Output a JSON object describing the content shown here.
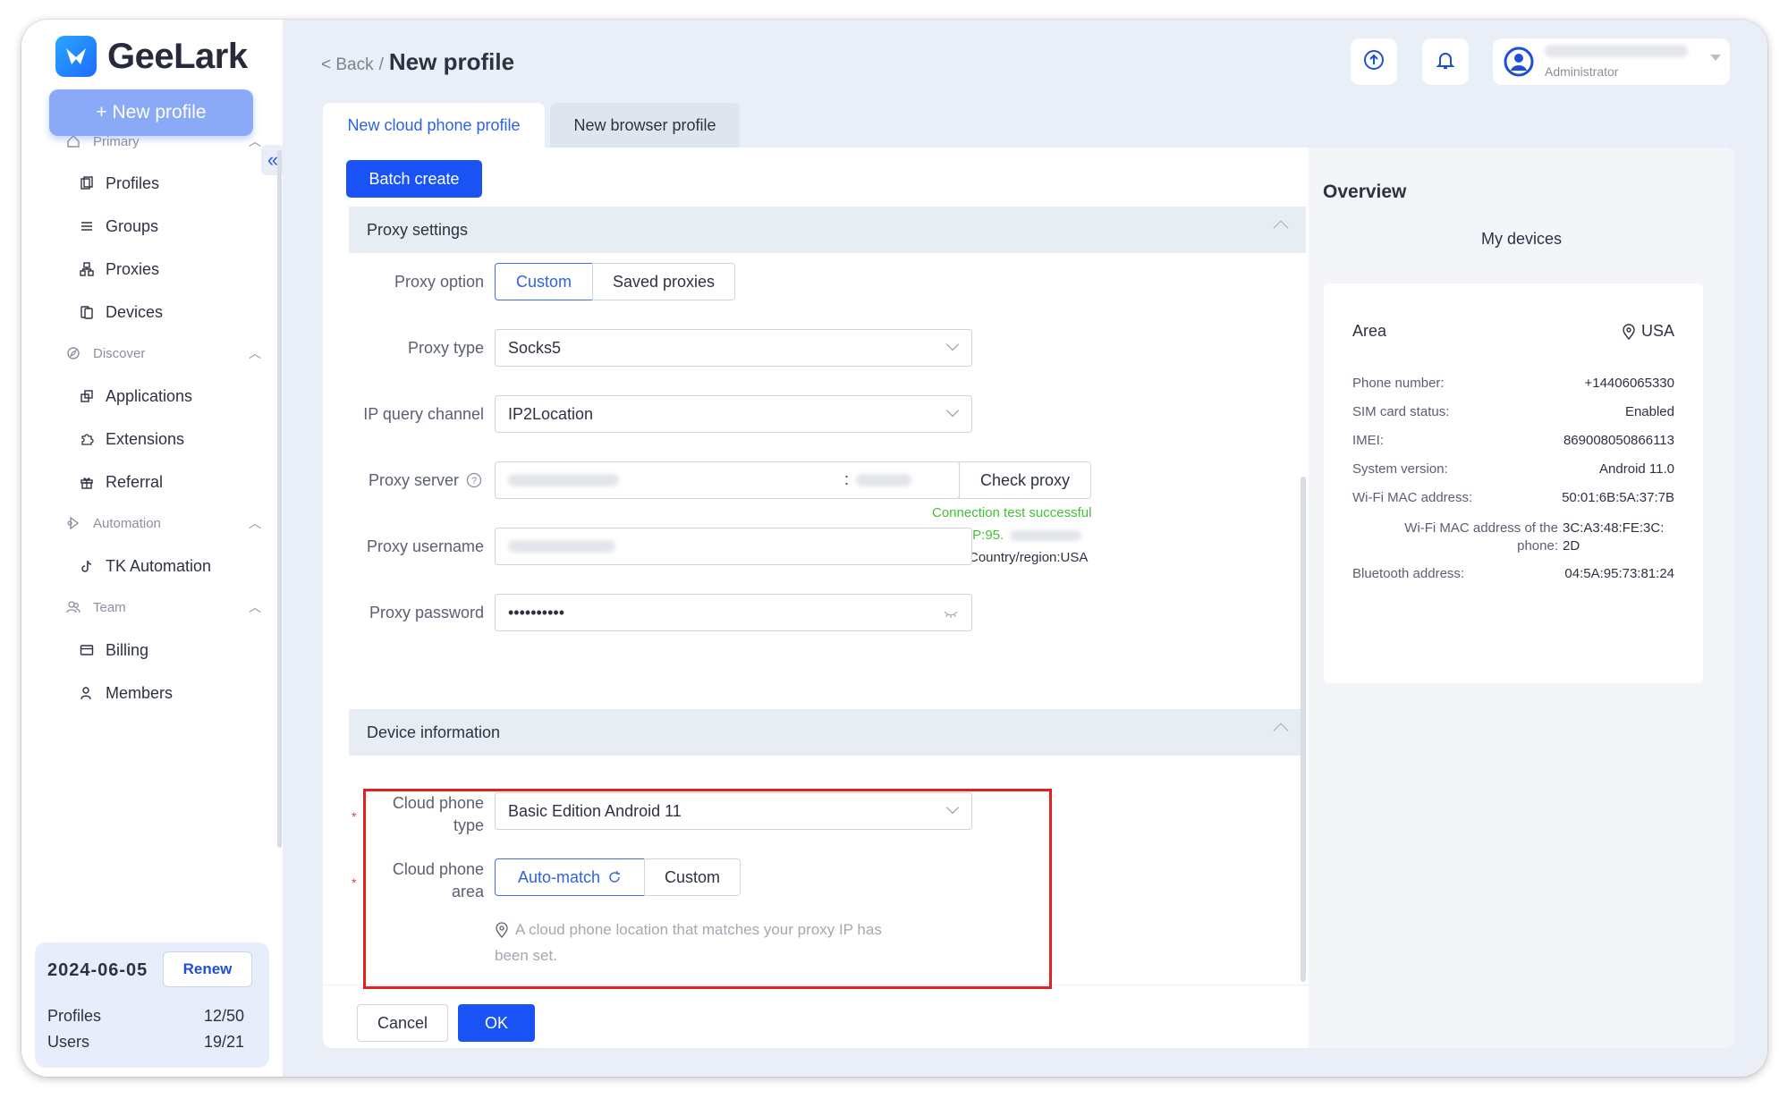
{
  "app": {
    "name": "GeeLark"
  },
  "sidebar": {
    "new_profile": "+ New profile",
    "collapse": "«",
    "sections": [
      {
        "label": "Primary",
        "items": [
          "Profiles",
          "Groups",
          "Proxies",
          "Devices"
        ]
      },
      {
        "label": "Discover",
        "items": [
          "Applications",
          "Extensions",
          "Referral"
        ]
      },
      {
        "label": "Automation",
        "items": [
          "TK Automation"
        ]
      },
      {
        "label": "Team",
        "items": [
          "Billing",
          "Members"
        ]
      }
    ],
    "plan": {
      "date": "2024-06-05",
      "renew": "Renew",
      "profiles_label": "Profiles",
      "profiles_value": "12/50",
      "users_label": "Users",
      "users_value": "19/21"
    }
  },
  "header": {
    "back": "< Back",
    "sep": "/",
    "title": "New profile",
    "user_role": "Administrator"
  },
  "tabs": [
    {
      "label": "New cloud phone profile",
      "active": true
    },
    {
      "label": "New browser profile",
      "active": false
    }
  ],
  "form": {
    "batch_create": "Batch create",
    "proxy_section": "Proxy settings",
    "proxy_option_label": "Proxy option",
    "proxy_option_custom": "Custom",
    "proxy_option_saved": "Saved proxies",
    "proxy_type_label": "Proxy type",
    "proxy_type_value": "Socks5",
    "ip_channel_label": "IP query channel",
    "ip_channel_value": "IP2Location",
    "proxy_server_label": "Proxy server",
    "proxy_server_colon": ":",
    "check_proxy": "Check proxy",
    "connection_status": "Connection test successful",
    "ip_prefix": "IP:95.",
    "country_info": "Country/region:USA",
    "proxy_username_label": "Proxy username",
    "proxy_password_label": "Proxy password",
    "proxy_password_value": "••••••••••",
    "device_section": "Device information",
    "phone_type_label_1": "Cloud phone",
    "phone_type_label_2": "type",
    "phone_type_value": "Basic Edition Android 11",
    "phone_area_label_1": "Cloud phone",
    "phone_area_label_2": "area",
    "area_auto": "Auto-match",
    "area_custom": "Custom",
    "area_hint_1": "A cloud phone location that matches your proxy IP has",
    "area_hint_2": "been set.",
    "required_mark": "*",
    "cancel": "Cancel",
    "ok": "OK"
  },
  "overview": {
    "title": "Overview",
    "subtitle": "My devices",
    "area_label": "Area",
    "area_value": "USA",
    "rows": [
      {
        "label": "Phone number:",
        "value": "+14406065330"
      },
      {
        "label": "SIM card status:",
        "value": "Enabled"
      },
      {
        "label": "IMEI:",
        "value": "869008050866113"
      },
      {
        "label": "System version:",
        "value": "Android 11.0"
      },
      {
        "label": "Wi-Fi MAC address:",
        "value": "50:01:6B:5A:37:7B"
      }
    ],
    "mac_phone_label_1": "Wi-Fi MAC address of the",
    "mac_phone_label_2": "phone:",
    "mac_phone_value_1": "3C:A3:48:FE:3C:",
    "mac_phone_value_2": "2D",
    "bt_label": "Bluetooth address:",
    "bt_value": "04:5A:95:73:81:24"
  },
  "colors": {
    "primary": "#1952f5",
    "success": "#41c036",
    "highlight": "#e02121"
  }
}
